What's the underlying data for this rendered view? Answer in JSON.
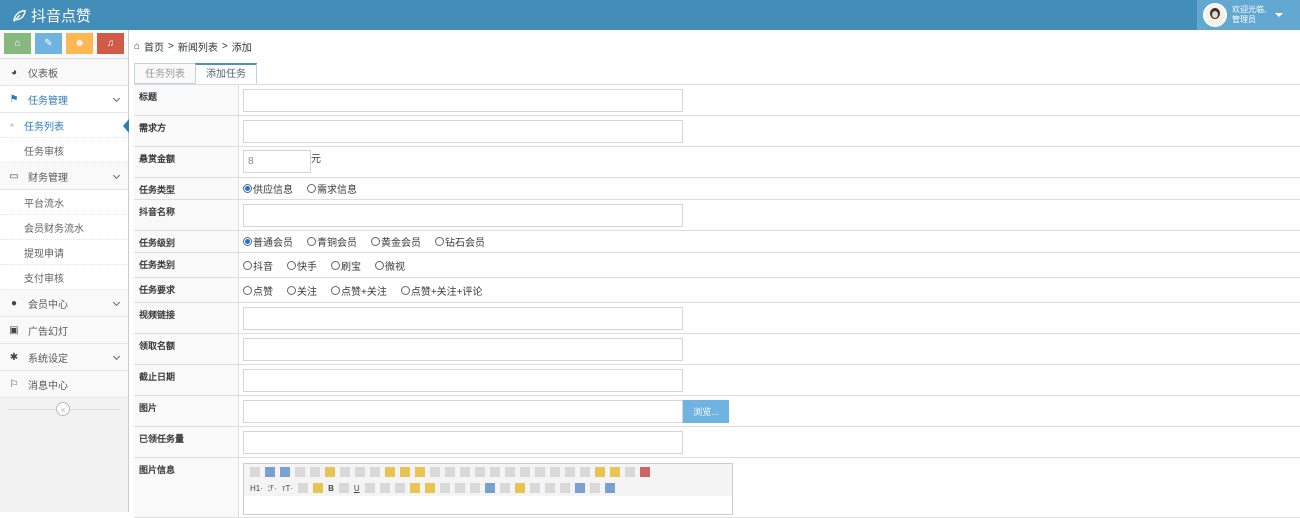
{
  "app": {
    "title": "抖音点赞"
  },
  "user": {
    "greeting": "欢迎光临,",
    "role": "管理员"
  },
  "breadcrumb": {
    "home": "首页",
    "sep1": ">",
    "list": "新闻列表",
    "sep2": ">",
    "current": "添加"
  },
  "tabs": [
    {
      "label": "任务列表"
    },
    {
      "label": "添加任务"
    }
  ],
  "sidebar": {
    "items": [
      {
        "label": "仪表板"
      },
      {
        "label": "任务管理"
      },
      {
        "label": "任务列表"
      },
      {
        "label": "任务审核"
      },
      {
        "label": "财务管理"
      },
      {
        "label": "平台流水"
      },
      {
        "label": "会员财务流水"
      },
      {
        "label": "提现申请"
      },
      {
        "label": "支付审核"
      },
      {
        "label": "会员中心"
      },
      {
        "label": "广告幻灯"
      },
      {
        "label": "系统设定"
      },
      {
        "label": "消息中心"
      }
    ]
  },
  "form": {
    "title_label": "标题",
    "requester_label": "需求方",
    "reward_label": "悬赏金额",
    "reward_value": "8",
    "reward_unit": "元",
    "type_label": "任务类型",
    "type_options": [
      "供应信息",
      "需求信息"
    ],
    "douyin_label": "抖音名称",
    "level_label": "任务级别",
    "level_options": [
      "普通会员",
      "青铜会员",
      "黄金会员",
      "钻石会员"
    ],
    "category_label": "任务类别",
    "category_options": [
      "抖音",
      "快手",
      "刷宝",
      "微视"
    ],
    "requirement_label": "任务要求",
    "requirement_options": [
      "点赞",
      "关注",
      "点赞+关注",
      "点赞+关注+评论"
    ],
    "video_label": "视频链接",
    "quota_label": "领取名额",
    "deadline_label": "截止日期",
    "image_label": "图片",
    "browse_label": "浏览...",
    "claimed_label": "已领任务量",
    "info_label": "图片信息"
  },
  "editor": {
    "h1": "H1·",
    "font": "ℱ·",
    "size": "ᴛT·"
  }
}
